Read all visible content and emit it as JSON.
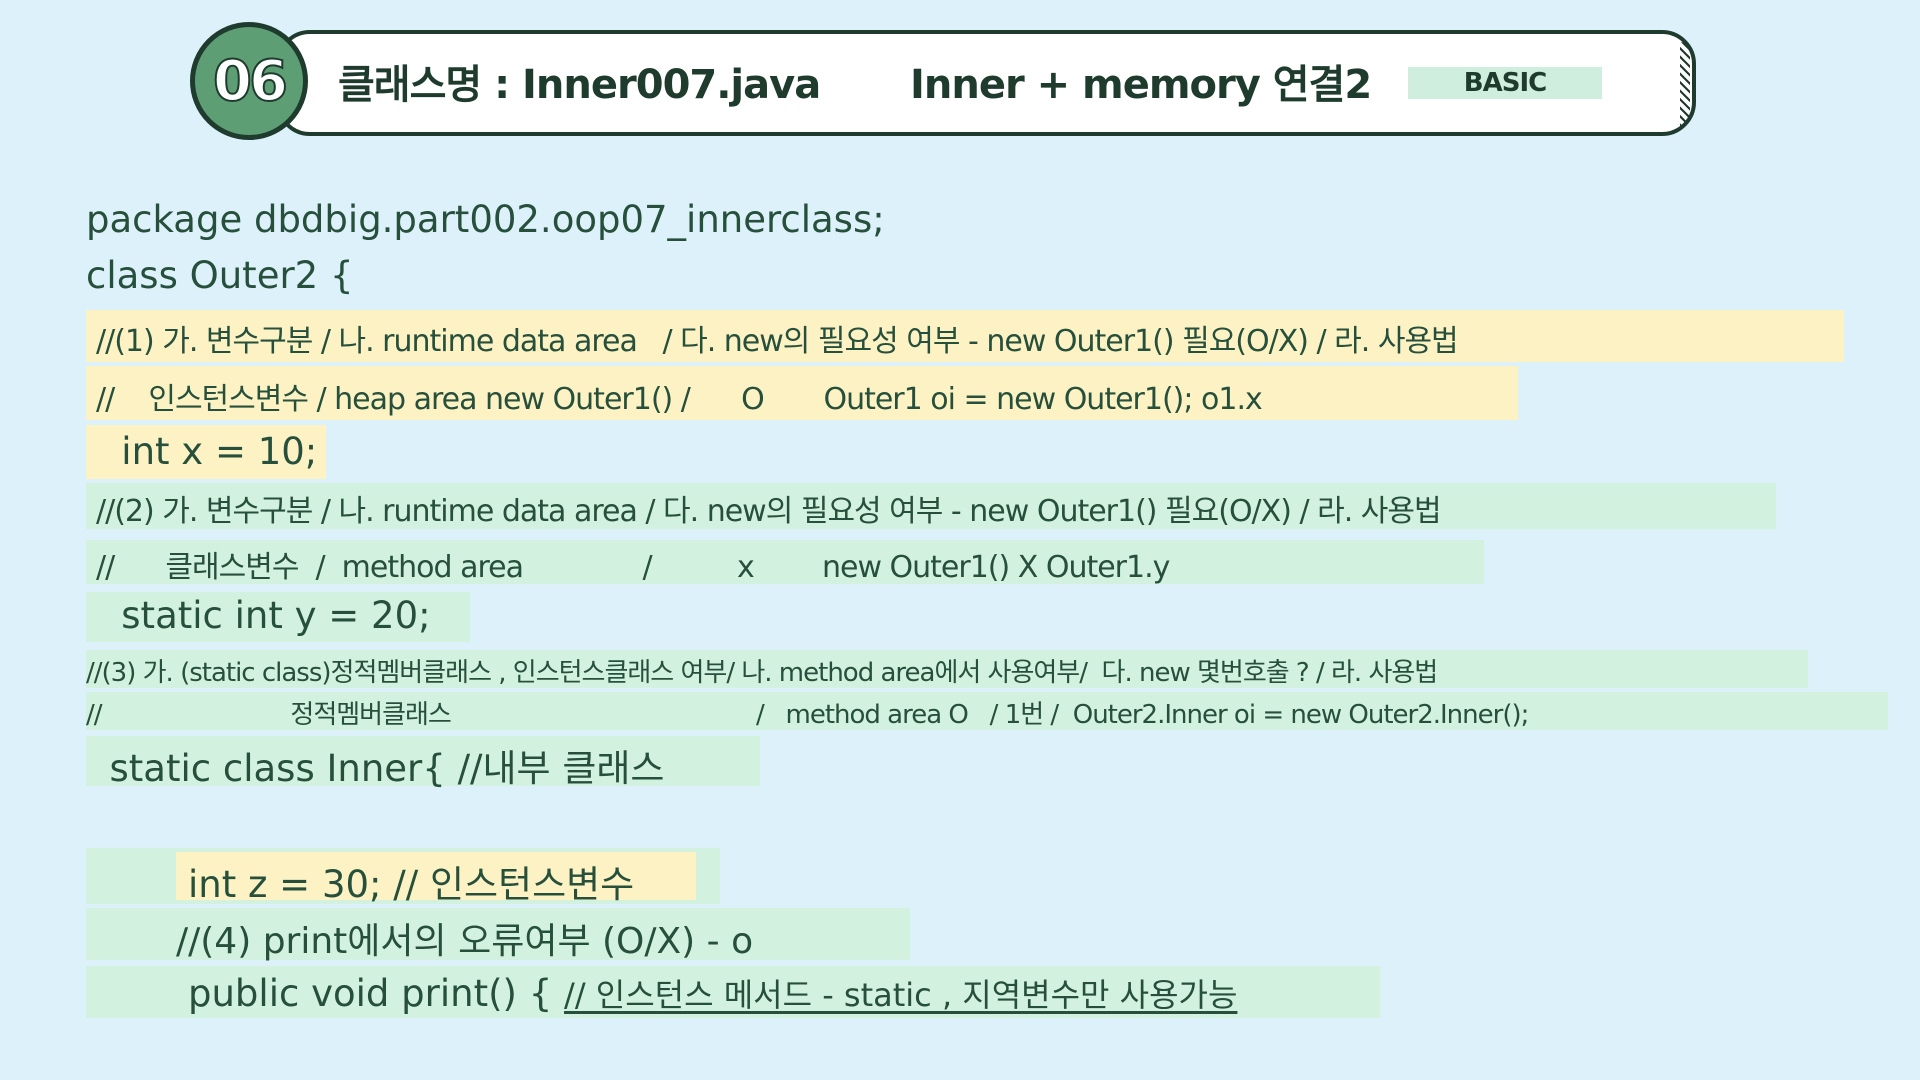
{
  "header": {
    "number": "06",
    "class_title": "클래스명 : Inner007.java",
    "topic": "Inner + memory 연결2",
    "level": "BASIC"
  },
  "code": {
    "l1": "package dbdbig.part002.oop07_innerclass;",
    "l2": "class Outer2 {",
    "l3": "//(1) 가. 변수구분 / 나. runtime data area   / 다. new의 필요성 여부 - new Outer1() 필요(O/X) / 라. 사용법",
    "l4": "//    인스턴스변수 / heap area new Outer1() /      O       Outer1 oi = new Outer1(); o1.x",
    "l5": "   int x = 10;",
    "l6": "//(2) 가. 변수구분 / 나. runtime data area / 다. new의 필요성 여부 - new Outer1() 필요(O/X) / 라. 사용법",
    "l7": "//      클래스변수  /  method area              /          x        new Outer1() X Outer1.y",
    "l8": "   static int y = 20;",
    "l9": "//(3) 가. (static class)정적멤버클래스 , 인스턴스클래스 여부/ 나. method area에서 사용여부/  다. new 몇번호출 ? / 라. 사용법",
    "l10": "//                          정적멤버클래스                                          /   method area O   / 1번 /  Outer2.Inner oi = new Outer2.Inner();",
    "l11": "  static class Inner{ //내부 클래스",
    "l12": "int z = 30; // 인스턴스변수",
    "l13": "//(4) print에서의 오류여부 (O/X) - o",
    "l14_code": "public void print() { ",
    "l14_comment": "// 인스턴스 메서드 - static , 지역변수만 사용가능"
  },
  "colors": {
    "background": "#ddf1fb",
    "highlight_yellow": "#fdf2c4",
    "highlight_green": "#d2f2df",
    "text": "#27503c",
    "badge": "#5e9e74"
  }
}
